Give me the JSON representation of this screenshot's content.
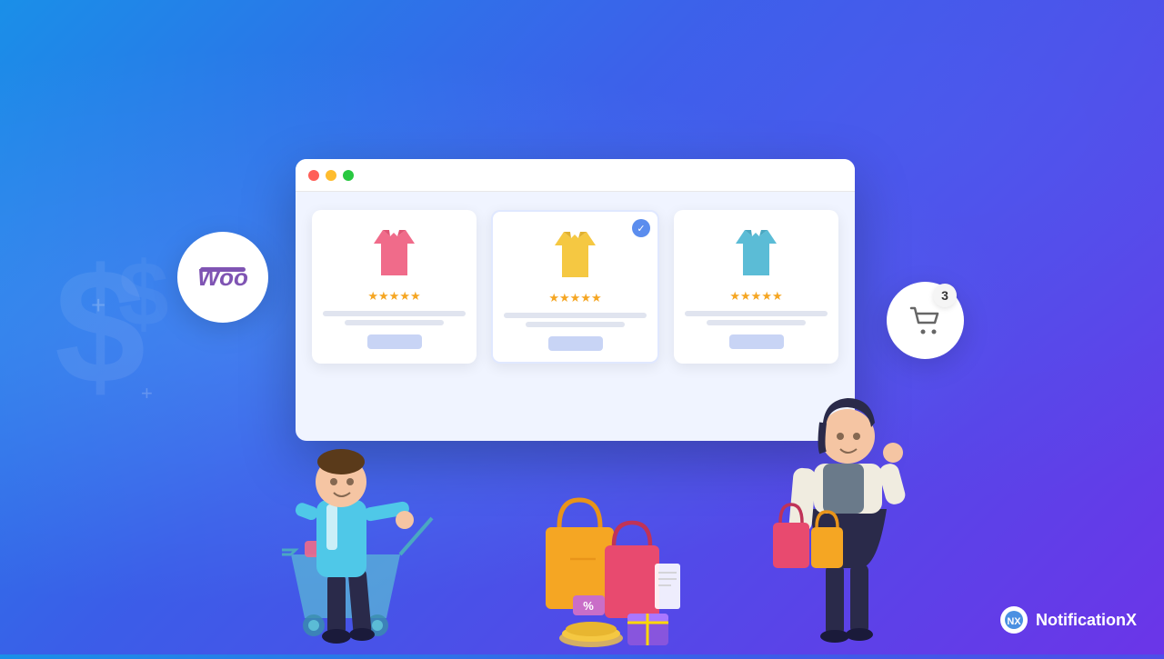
{
  "background": {
    "gradient_start": "#1a8fe8",
    "gradient_end": "#6b35e8"
  },
  "woo_badge": {
    "text": "Woo",
    "color": "#7f54b3"
  },
  "cart_badge": {
    "count": "3",
    "icon": "🛒"
  },
  "browser": {
    "dots": [
      "red",
      "yellow",
      "green"
    ],
    "products": [
      {
        "id": 1,
        "shirt_color": "#f06b8a",
        "stars": 5,
        "selected": false
      },
      {
        "id": 2,
        "shirt_color": "#f5c842",
        "stars": 5,
        "selected": true
      },
      {
        "id": 3,
        "shirt_color": "#5bbcd6",
        "stars": 5,
        "selected": false
      }
    ]
  },
  "branding": {
    "name": "NotificationX",
    "logo_text": "NX"
  },
  "decorative": {
    "dollar_symbol": "$",
    "plus_symbol": "+"
  }
}
